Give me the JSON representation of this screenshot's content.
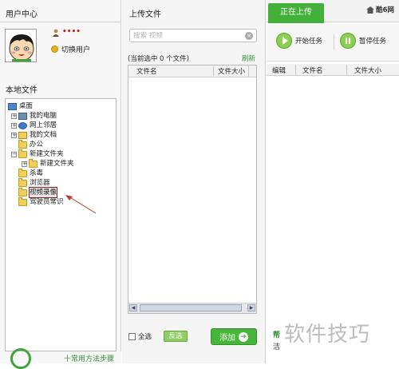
{
  "user_center": {
    "title": "用户中心",
    "username": "••••",
    "switch_user": "切换用户"
  },
  "local_files": {
    "title": "本地文件",
    "tree": [
      {
        "label": "桌面",
        "icon": "desktop-icon"
      },
      {
        "label": "我的电脑",
        "icon": "computer-icon"
      },
      {
        "label": "网上邻居",
        "icon": "network-icon"
      },
      {
        "label": "我的文档",
        "icon": "documents-icon"
      },
      {
        "label": "办公",
        "icon": "folder-icon"
      },
      {
        "label": "新建文件夹",
        "icon": "folder-icon"
      },
      {
        "label": "新建文件夹",
        "icon": "folder-icon"
      },
      {
        "label": "杀毒",
        "icon": "folder-icon"
      },
      {
        "label": "浏览器",
        "icon": "folder-icon"
      },
      {
        "label": "视频录像",
        "icon": "folder-icon",
        "selected": true
      },
      {
        "label": "驾驶员常识",
        "icon": "folder-icon"
      }
    ]
  },
  "upload": {
    "title": "上传文件",
    "search_placeholder": "搜索 视频",
    "selected_count": "(当前选中 0 个文件)",
    "refresh": "刷新",
    "columns": {
      "name": "文件名",
      "size": "文件大小"
    },
    "select_all": "全选",
    "invert": "反选",
    "add": "添加"
  },
  "uploading": {
    "tab": "正在上传",
    "logo": "酷6网",
    "start": "开始任务",
    "pause": "暂停任务",
    "columns": {
      "edit": "编辑",
      "name": "文件名",
      "size": "文件大小"
    },
    "footer_a": "帮",
    "footer_b": "洁"
  },
  "bottom_text": "十常用方法步骤",
  "watermark": "软件技巧",
  "colors": {
    "green": "#43b03a",
    "selection_border": "#8a1d1d",
    "username": "#c21c1c",
    "arrow": "#c0392b"
  }
}
